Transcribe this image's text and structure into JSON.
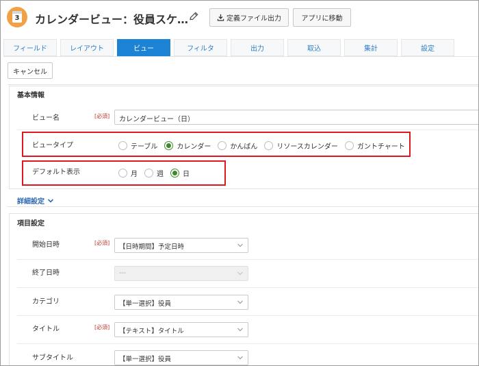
{
  "app": {
    "icon_number": "3",
    "title": "カレンダービュー：役員スケ…",
    "export_button": "定義ファイル出力",
    "move_button": "アプリに移動"
  },
  "tabs": [
    {
      "label": "フィールド",
      "active": false
    },
    {
      "label": "レイアウト",
      "active": false
    },
    {
      "label": "ビュー",
      "active": true
    },
    {
      "label": "フィルタ",
      "active": false
    },
    {
      "label": "出力",
      "active": false
    },
    {
      "label": "取込",
      "active": false
    },
    {
      "label": "集計",
      "active": false
    },
    {
      "label": "設定",
      "active": false
    }
  ],
  "cancel_button": "キャンセル",
  "basic": {
    "title": "基本情報",
    "view_name_label": "ビュー名",
    "required": "[必須]",
    "view_name_value": "カレンダービュー（日）",
    "view_type_label": "ビュータイプ",
    "view_type_options": [
      "テーブル",
      "カレンダー",
      "かんばん",
      "リソースカレンダー",
      "ガントチャート"
    ],
    "view_type_selected": "カレンダー",
    "default_display_label": "デフォルト表示",
    "default_display_options": [
      "月",
      "週",
      "日"
    ],
    "default_display_selected": "日"
  },
  "detail_settings": "詳細設定",
  "items": {
    "title": "項目設定",
    "rows": [
      {
        "label": "開始日時",
        "required": "[必須]",
        "value": "【日時期間】予定日時",
        "disabled": false
      },
      {
        "label": "終了日時",
        "required": "",
        "value": "---",
        "disabled": true
      },
      {
        "label": "カテゴリ",
        "required": "",
        "value": "【単一選択】役員",
        "disabled": false
      },
      {
        "label": "タイトル",
        "required": "[必須]",
        "value": "【テキスト】タイトル",
        "disabled": false
      },
      {
        "label": "サブタイトル",
        "required": "",
        "value": "【単一選択】役員",
        "disabled": false
      }
    ]
  },
  "colors": {
    "accent": "#1d83d4",
    "link": "#2f6ab3",
    "radio_checked": "#3b8a2a",
    "highlight": "#e0171f",
    "required": "#c0392b",
    "app_icon": "#f0a145"
  }
}
